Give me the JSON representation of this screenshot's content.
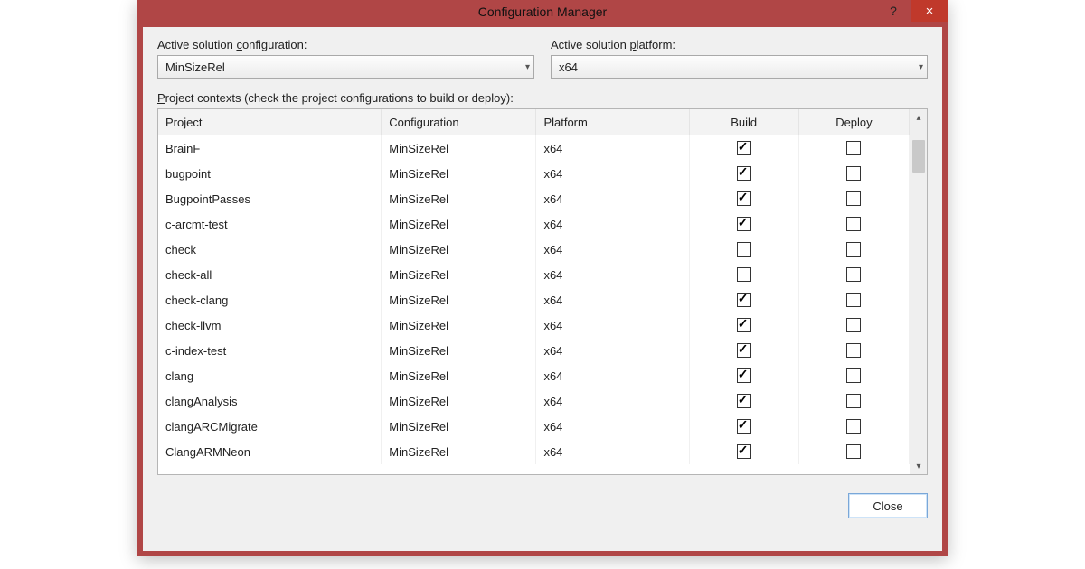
{
  "window": {
    "title": "Configuration Manager"
  },
  "dropdowns": {
    "solution_config_label_pre": "Active solution ",
    "solution_config_label_u": "c",
    "solution_config_label_post": "onfiguration:",
    "solution_config_value": "MinSizeRel",
    "solution_platform_label_pre": "Active solution ",
    "solution_platform_label_u": "p",
    "solution_platform_label_post": "latform:",
    "solution_platform_value": "x64"
  },
  "grid": {
    "section_label_u": "P",
    "section_label_rest": "roject contexts (check the project configurations to build or deploy):",
    "columns": {
      "project": "Project",
      "configuration": "Configuration",
      "platform": "Platform",
      "build": "Build",
      "deploy": "Deploy"
    },
    "rows": [
      {
        "project": "BrainF",
        "configuration": "MinSizeRel",
        "platform": "x64",
        "build": true,
        "deploy": false
      },
      {
        "project": "bugpoint",
        "configuration": "MinSizeRel",
        "platform": "x64",
        "build": true,
        "deploy": false
      },
      {
        "project": "BugpointPasses",
        "configuration": "MinSizeRel",
        "platform": "x64",
        "build": true,
        "deploy": false
      },
      {
        "project": "c-arcmt-test",
        "configuration": "MinSizeRel",
        "platform": "x64",
        "build": true,
        "deploy": false
      },
      {
        "project": "check",
        "configuration": "MinSizeRel",
        "platform": "x64",
        "build": false,
        "deploy": false
      },
      {
        "project": "check-all",
        "configuration": "MinSizeRel",
        "platform": "x64",
        "build": false,
        "deploy": false
      },
      {
        "project": "check-clang",
        "configuration": "MinSizeRel",
        "platform": "x64",
        "build": true,
        "deploy": false
      },
      {
        "project": "check-llvm",
        "configuration": "MinSizeRel",
        "platform": "x64",
        "build": true,
        "deploy": false
      },
      {
        "project": "c-index-test",
        "configuration": "MinSizeRel",
        "platform": "x64",
        "build": true,
        "deploy": false
      },
      {
        "project": "clang",
        "configuration": "MinSizeRel",
        "platform": "x64",
        "build": true,
        "deploy": false
      },
      {
        "project": "clangAnalysis",
        "configuration": "MinSizeRel",
        "platform": "x64",
        "build": true,
        "deploy": false
      },
      {
        "project": "clangARCMigrate",
        "configuration": "MinSizeRel",
        "platform": "x64",
        "build": true,
        "deploy": false
      },
      {
        "project": "ClangARMNeon",
        "configuration": "MinSizeRel",
        "platform": "x64",
        "build": true,
        "deploy": false
      }
    ]
  },
  "footer": {
    "close_label": "Close"
  }
}
